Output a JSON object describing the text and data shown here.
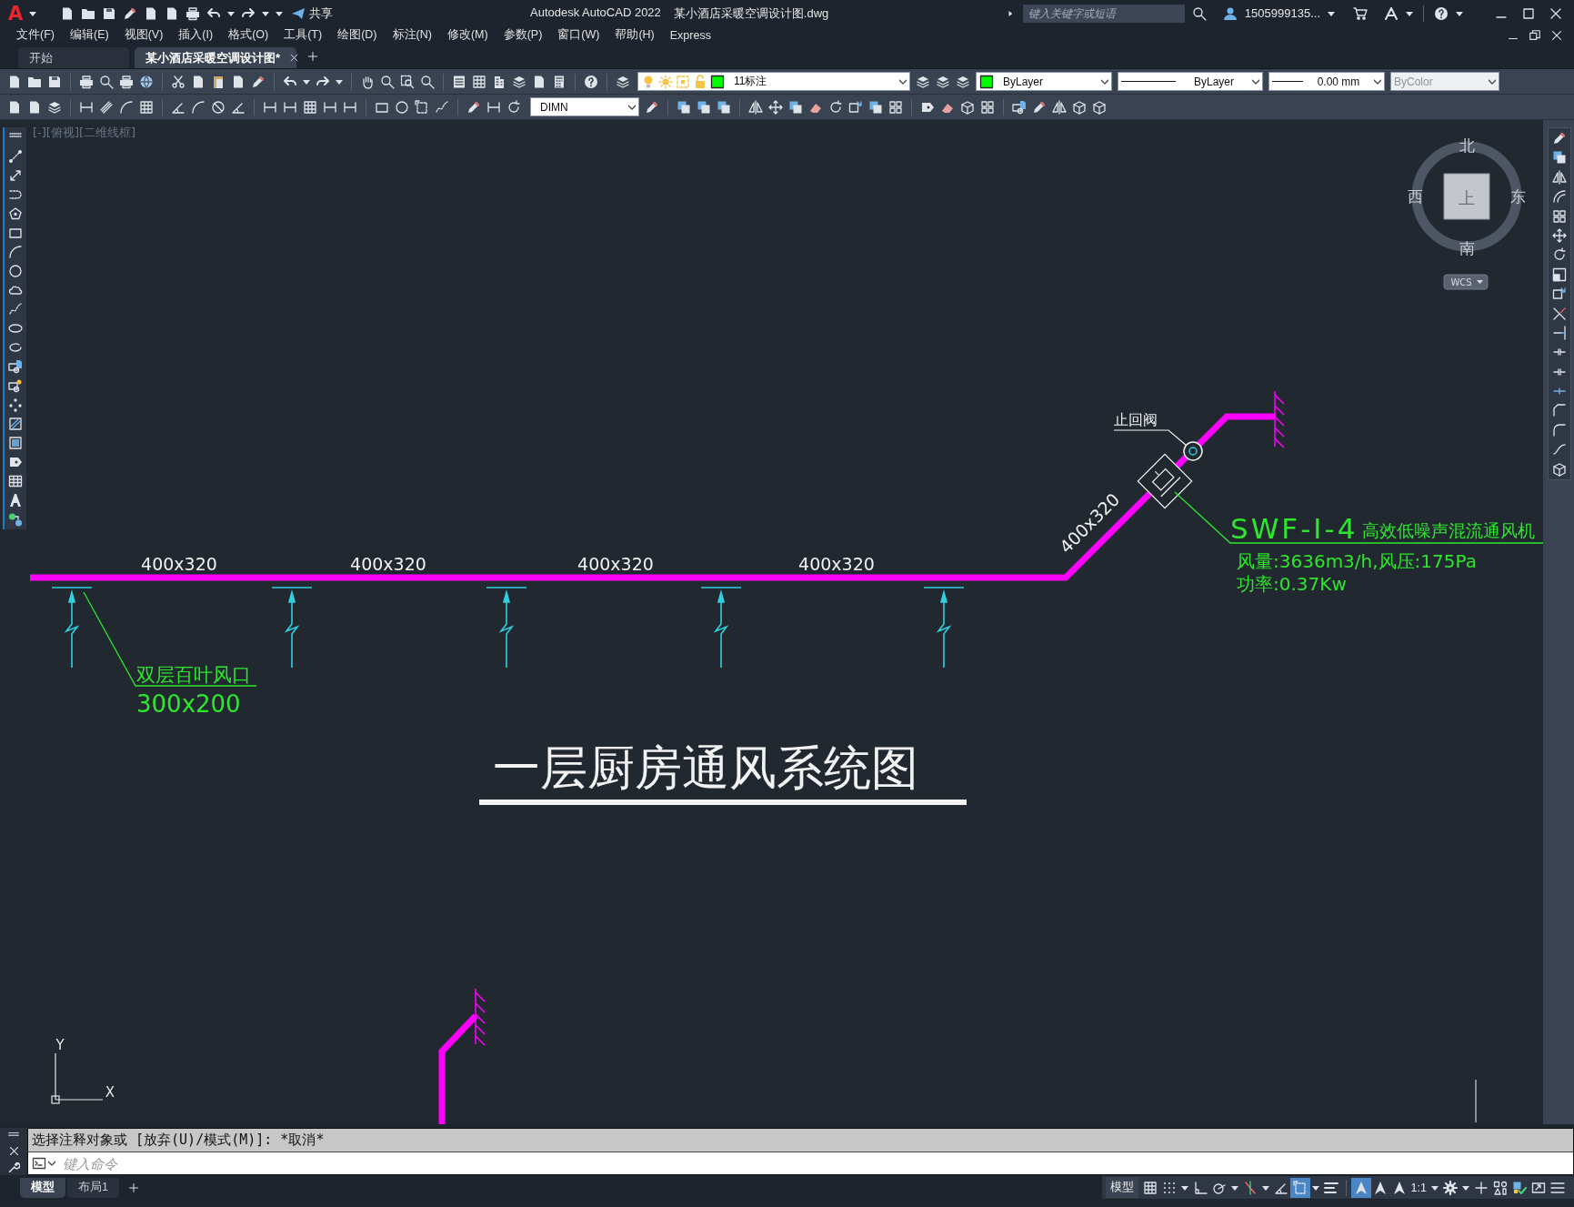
{
  "window": {
    "app_logo": "A",
    "app_title": "Autodesk AutoCAD 2022",
    "file_title": "某小酒店采暖空调设计图.dwg"
  },
  "quick_access": {
    "share": "共享"
  },
  "search": {
    "placeholder": "键入关键字或短语"
  },
  "user": {
    "name": "1505999135..."
  },
  "menu": [
    "文件(F)",
    "编辑(E)",
    "视图(V)",
    "插入(I)",
    "格式(O)",
    "工具(T)",
    "绘图(D)",
    "标注(N)",
    "修改(M)",
    "参数(P)",
    "窗口(W)",
    "帮助(H)",
    "Express"
  ],
  "doc_tabs": [
    {
      "label": "开始",
      "selected": false
    },
    {
      "label": "某小酒店采暖空调设计图*",
      "selected": true
    }
  ],
  "layer": {
    "value": "11标注"
  },
  "properties": {
    "color_setting": "ByLayer",
    "linetype": "ByLayer",
    "lineweight": "0.00 mm",
    "plotstyle": "ByColor",
    "plotstyle_disabled": true
  },
  "dimstyle": {
    "value": "DIMN"
  },
  "viewport_label": "[-][俯视][二维线框]",
  "compass": {
    "north": "北",
    "south": "南",
    "west": "西",
    "east": "东",
    "cube_face": "上",
    "ucs": "WCS"
  },
  "drawing": {
    "duct_labels": [
      "400x320",
      "400x320",
      "400x320",
      "400x320"
    ],
    "riser_label": "400x320",
    "outlet_label": "双层百叶风口",
    "outlet_size": "300x200",
    "valve_label": "止回阀",
    "fan_model": "SWF-I-4",
    "fan_name": "高效低噪声混流通风机",
    "fan_specs": [
      "风量:3636m3/h,风压:175Pa",
      "功率:0.37Kw"
    ],
    "title": "一层厨房通风系统图"
  },
  "ucs_axes": {
    "y": "Y",
    "x": "X"
  },
  "command": {
    "history": "选择注释对象或 [放弃(U)/模式(M)]: *取消*",
    "placeholder": "键入命令"
  },
  "layout_tabs": [
    {
      "label": "模型",
      "selected": true
    },
    {
      "label": "布局1",
      "selected": false
    }
  ],
  "status": {
    "space": "模型",
    "scale": "1:1",
    "toggles": [
      {
        "kind": "grid",
        "on": false
      },
      {
        "kind": "snap",
        "on": false
      },
      {
        "kind": "ortho",
        "on": false
      },
      {
        "kind": "polar",
        "on": false
      },
      {
        "kind": "osnap-track",
        "on": false
      },
      {
        "kind": "isometric",
        "on": false
      },
      {
        "kind": "selection",
        "on": true
      },
      {
        "kind": "lineweight",
        "on": false
      },
      {
        "kind": "annotation",
        "on": true
      },
      {
        "kind": "autoscale",
        "on": false
      },
      {
        "kind": "annoscale",
        "on": false
      }
    ]
  }
}
